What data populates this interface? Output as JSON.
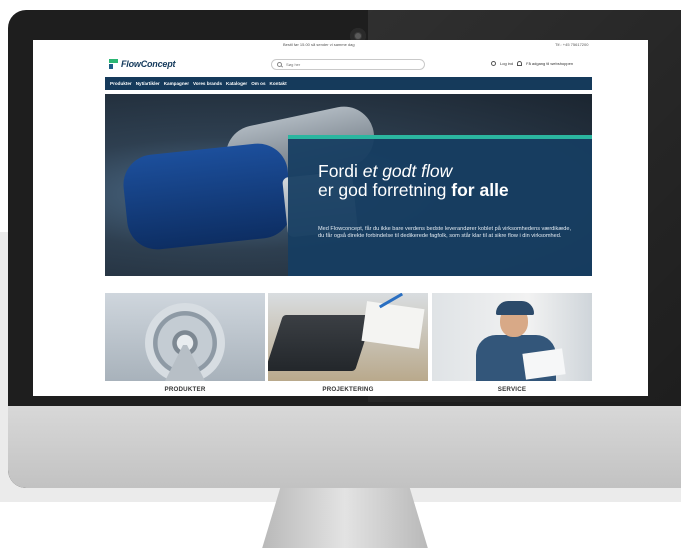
{
  "topbar": {
    "notice": "Bestil før 15.00 så sender vi samme dag",
    "phone": "Tlf.: +45 75617200"
  },
  "header": {
    "logo_text": "FlowConcept",
    "search_placeholder": "Søg her",
    "login_label": "Log ind",
    "access_label": "Få adgang til webshoppen"
  },
  "nav": {
    "items": [
      {
        "label": "Produkter"
      },
      {
        "label": "Nyt/artikler"
      },
      {
        "label": "Kampagner"
      },
      {
        "label": "Vores brands"
      },
      {
        "label": "Kataloger"
      },
      {
        "label": "Om os"
      },
      {
        "label": "Kontakt"
      }
    ]
  },
  "hero": {
    "title_part1": "Fordi ",
    "title_em": "et godt flow",
    "title_part2": "er god forretning ",
    "title_bold": "for alle",
    "body": "Med Flowconcept, får du ikke bare verdens bedste leverandører koblet på virksomhedens værdikæde, du får også direkte forbindelse til dedikerede fagfolk, som står klar til at sikre flow i din virksomhed."
  },
  "cards": [
    {
      "label": "PRODUKTER"
    },
    {
      "label": "PROJEKTERING"
    },
    {
      "label": "SERVICE"
    }
  ],
  "colors": {
    "brand_navy": "#153a5b",
    "brand_green": "#2bb673",
    "accent_orange": "#f1963a",
    "hero_panel": "#163e62"
  },
  "icons": [
    "camera-icon",
    "logo-mark-icon",
    "search-icon",
    "user-icon",
    "user-plus-icon"
  ]
}
